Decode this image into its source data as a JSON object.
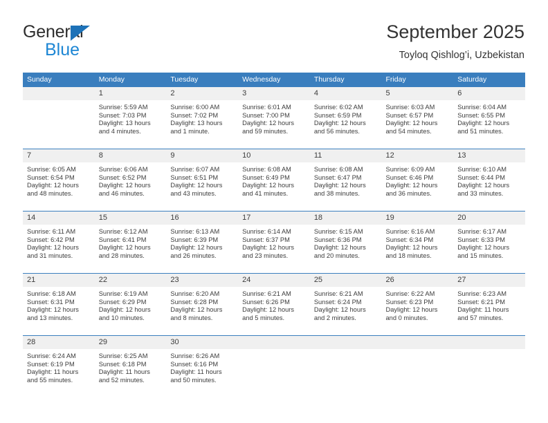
{
  "brand": {
    "name_top": "General",
    "name_bottom": "Blue",
    "triangle_color": "#1d72b8",
    "blue_color": "#1d86d4"
  },
  "header": {
    "title": "September 2025",
    "subtitle": "Toyloq Qishlog’i, Uzbekistan"
  },
  "theme": {
    "header_bg": "#3a7ebe",
    "header_text": "#ffffff",
    "daynum_bg": "#f0f0f0",
    "cell_text": "#3c3c3c"
  },
  "weekday_headers": [
    "Sunday",
    "Monday",
    "Tuesday",
    "Wednesday",
    "Thursday",
    "Friday",
    "Saturday"
  ],
  "weeks": [
    [
      {
        "day": "",
        "blank": true,
        "sunrise": "",
        "sunset": "",
        "daylight_1": "",
        "daylight_2": ""
      },
      {
        "day": "1",
        "blank": false,
        "sunrise": "Sunrise: 5:59 AM",
        "sunset": "Sunset: 7:03 PM",
        "daylight_1": "Daylight: 13 hours",
        "daylight_2": "and 4 minutes."
      },
      {
        "day": "2",
        "blank": false,
        "sunrise": "Sunrise: 6:00 AM",
        "sunset": "Sunset: 7:02 PM",
        "daylight_1": "Daylight: 13 hours",
        "daylight_2": "and 1 minute."
      },
      {
        "day": "3",
        "blank": false,
        "sunrise": "Sunrise: 6:01 AM",
        "sunset": "Sunset: 7:00 PM",
        "daylight_1": "Daylight: 12 hours",
        "daylight_2": "and 59 minutes."
      },
      {
        "day": "4",
        "blank": false,
        "sunrise": "Sunrise: 6:02 AM",
        "sunset": "Sunset: 6:59 PM",
        "daylight_1": "Daylight: 12 hours",
        "daylight_2": "and 56 minutes."
      },
      {
        "day": "5",
        "blank": false,
        "sunrise": "Sunrise: 6:03 AM",
        "sunset": "Sunset: 6:57 PM",
        "daylight_1": "Daylight: 12 hours",
        "daylight_2": "and 54 minutes."
      },
      {
        "day": "6",
        "blank": false,
        "sunrise": "Sunrise: 6:04 AM",
        "sunset": "Sunset: 6:55 PM",
        "daylight_1": "Daylight: 12 hours",
        "daylight_2": "and 51 minutes."
      }
    ],
    [
      {
        "day": "7",
        "blank": false,
        "sunrise": "Sunrise: 6:05 AM",
        "sunset": "Sunset: 6:54 PM",
        "daylight_1": "Daylight: 12 hours",
        "daylight_2": "and 48 minutes."
      },
      {
        "day": "8",
        "blank": false,
        "sunrise": "Sunrise: 6:06 AM",
        "sunset": "Sunset: 6:52 PM",
        "daylight_1": "Daylight: 12 hours",
        "daylight_2": "and 46 minutes."
      },
      {
        "day": "9",
        "blank": false,
        "sunrise": "Sunrise: 6:07 AM",
        "sunset": "Sunset: 6:51 PM",
        "daylight_1": "Daylight: 12 hours",
        "daylight_2": "and 43 minutes."
      },
      {
        "day": "10",
        "blank": false,
        "sunrise": "Sunrise: 6:08 AM",
        "sunset": "Sunset: 6:49 PM",
        "daylight_1": "Daylight: 12 hours",
        "daylight_2": "and 41 minutes."
      },
      {
        "day": "11",
        "blank": false,
        "sunrise": "Sunrise: 6:08 AM",
        "sunset": "Sunset: 6:47 PM",
        "daylight_1": "Daylight: 12 hours",
        "daylight_2": "and 38 minutes."
      },
      {
        "day": "12",
        "blank": false,
        "sunrise": "Sunrise: 6:09 AM",
        "sunset": "Sunset: 6:46 PM",
        "daylight_1": "Daylight: 12 hours",
        "daylight_2": "and 36 minutes."
      },
      {
        "day": "13",
        "blank": false,
        "sunrise": "Sunrise: 6:10 AM",
        "sunset": "Sunset: 6:44 PM",
        "daylight_1": "Daylight: 12 hours",
        "daylight_2": "and 33 minutes."
      }
    ],
    [
      {
        "day": "14",
        "blank": false,
        "sunrise": "Sunrise: 6:11 AM",
        "sunset": "Sunset: 6:42 PM",
        "daylight_1": "Daylight: 12 hours",
        "daylight_2": "and 31 minutes."
      },
      {
        "day": "15",
        "blank": false,
        "sunrise": "Sunrise: 6:12 AM",
        "sunset": "Sunset: 6:41 PM",
        "daylight_1": "Daylight: 12 hours",
        "daylight_2": "and 28 minutes."
      },
      {
        "day": "16",
        "blank": false,
        "sunrise": "Sunrise: 6:13 AM",
        "sunset": "Sunset: 6:39 PM",
        "daylight_1": "Daylight: 12 hours",
        "daylight_2": "and 26 minutes."
      },
      {
        "day": "17",
        "blank": false,
        "sunrise": "Sunrise: 6:14 AM",
        "sunset": "Sunset: 6:37 PM",
        "daylight_1": "Daylight: 12 hours",
        "daylight_2": "and 23 minutes."
      },
      {
        "day": "18",
        "blank": false,
        "sunrise": "Sunrise: 6:15 AM",
        "sunset": "Sunset: 6:36 PM",
        "daylight_1": "Daylight: 12 hours",
        "daylight_2": "and 20 minutes."
      },
      {
        "day": "19",
        "blank": false,
        "sunrise": "Sunrise: 6:16 AM",
        "sunset": "Sunset: 6:34 PM",
        "daylight_1": "Daylight: 12 hours",
        "daylight_2": "and 18 minutes."
      },
      {
        "day": "20",
        "blank": false,
        "sunrise": "Sunrise: 6:17 AM",
        "sunset": "Sunset: 6:33 PM",
        "daylight_1": "Daylight: 12 hours",
        "daylight_2": "and 15 minutes."
      }
    ],
    [
      {
        "day": "21",
        "blank": false,
        "sunrise": "Sunrise: 6:18 AM",
        "sunset": "Sunset: 6:31 PM",
        "daylight_1": "Daylight: 12 hours",
        "daylight_2": "and 13 minutes."
      },
      {
        "day": "22",
        "blank": false,
        "sunrise": "Sunrise: 6:19 AM",
        "sunset": "Sunset: 6:29 PM",
        "daylight_1": "Daylight: 12 hours",
        "daylight_2": "and 10 minutes."
      },
      {
        "day": "23",
        "blank": false,
        "sunrise": "Sunrise: 6:20 AM",
        "sunset": "Sunset: 6:28 PM",
        "daylight_1": "Daylight: 12 hours",
        "daylight_2": "and 8 minutes."
      },
      {
        "day": "24",
        "blank": false,
        "sunrise": "Sunrise: 6:21 AM",
        "sunset": "Sunset: 6:26 PM",
        "daylight_1": "Daylight: 12 hours",
        "daylight_2": "and 5 minutes."
      },
      {
        "day": "25",
        "blank": false,
        "sunrise": "Sunrise: 6:21 AM",
        "sunset": "Sunset: 6:24 PM",
        "daylight_1": "Daylight: 12 hours",
        "daylight_2": "and 2 minutes."
      },
      {
        "day": "26",
        "blank": false,
        "sunrise": "Sunrise: 6:22 AM",
        "sunset": "Sunset: 6:23 PM",
        "daylight_1": "Daylight: 12 hours",
        "daylight_2": "and 0 minutes."
      },
      {
        "day": "27",
        "blank": false,
        "sunrise": "Sunrise: 6:23 AM",
        "sunset": "Sunset: 6:21 PM",
        "daylight_1": "Daylight: 11 hours",
        "daylight_2": "and 57 minutes."
      }
    ],
    [
      {
        "day": "28",
        "blank": false,
        "sunrise": "Sunrise: 6:24 AM",
        "sunset": "Sunset: 6:19 PM",
        "daylight_1": "Daylight: 11 hours",
        "daylight_2": "and 55 minutes."
      },
      {
        "day": "29",
        "blank": false,
        "sunrise": "Sunrise: 6:25 AM",
        "sunset": "Sunset: 6:18 PM",
        "daylight_1": "Daylight: 11 hours",
        "daylight_2": "and 52 minutes."
      },
      {
        "day": "30",
        "blank": false,
        "sunrise": "Sunrise: 6:26 AM",
        "sunset": "Sunset: 6:16 PM",
        "daylight_1": "Daylight: 11 hours",
        "daylight_2": "and 50 minutes."
      },
      {
        "day": "",
        "blank": true,
        "sunrise": "",
        "sunset": "",
        "daylight_1": "",
        "daylight_2": ""
      },
      {
        "day": "",
        "blank": true,
        "sunrise": "",
        "sunset": "",
        "daylight_1": "",
        "daylight_2": ""
      },
      {
        "day": "",
        "blank": true,
        "sunrise": "",
        "sunset": "",
        "daylight_1": "",
        "daylight_2": ""
      },
      {
        "day": "",
        "blank": true,
        "sunrise": "",
        "sunset": "",
        "daylight_1": "",
        "daylight_2": ""
      }
    ]
  ]
}
